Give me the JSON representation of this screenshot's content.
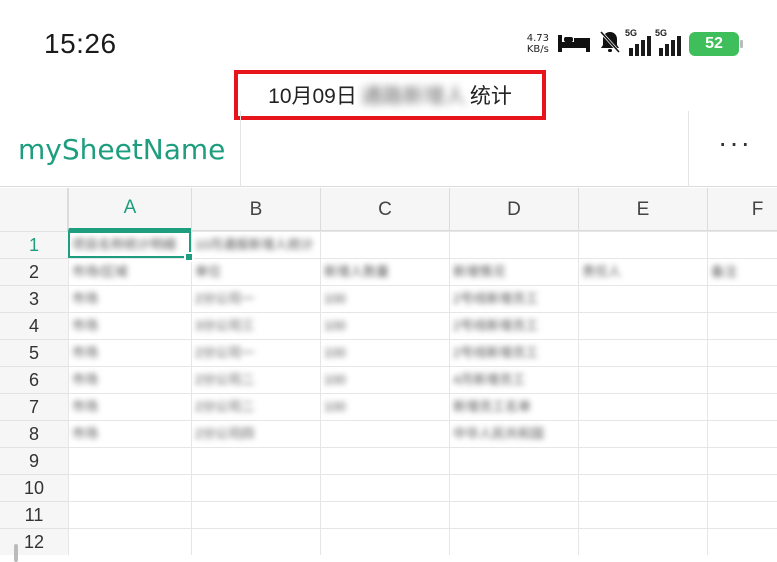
{
  "status_bar": {
    "time": "15:26",
    "net_speed_value": "4.73",
    "net_speed_unit": "KB/s",
    "signal1_label": "5G",
    "signal2_label": "5G",
    "battery": "52",
    "icons": [
      "bed-icon",
      "bell-muted-icon",
      "signal-icon",
      "signal-icon",
      "battery-icon"
    ],
    "battery_color": "#3fbf5b"
  },
  "document": {
    "title_prefix": "10月09日",
    "title_hidden": "通路新增人",
    "title_suffix": "统计",
    "highlight_color": "#e8141b"
  },
  "sheet": {
    "name": "mySheetName",
    "more_label": "···",
    "accent": "#1e9e7e"
  },
  "grid": {
    "columns": [
      "A",
      "B",
      "C",
      "D",
      "E",
      "F"
    ],
    "rows": [
      "1",
      "2",
      "3",
      "4",
      "5",
      "6",
      "7",
      "8",
      "9",
      "10",
      "11",
      "12"
    ],
    "cells": [
      [
        "项目名称统计明细",
        "10月通报新增人统计",
        "",
        "",
        "",
        ""
      ],
      [
        "市场/区域",
        "单位",
        "新增人数量",
        "新增情况",
        "责任人",
        "备注"
      ],
      [
        "市场",
        "2分公司一",
        "100",
        "2号线新增员工",
        "",
        ""
      ],
      [
        "市场",
        "3分公司三",
        "100",
        "2号线新增员工",
        "",
        ""
      ],
      [
        "市场",
        "2分公司一",
        "100",
        "2号线新增员工",
        "",
        ""
      ],
      [
        "市场",
        "2分公司二",
        "100",
        "4月新增员工",
        "",
        ""
      ],
      [
        "市场",
        "2分公司二",
        "100",
        "新增员工名单",
        "",
        ""
      ],
      [
        "市场",
        "2分公司四",
        "",
        "中华人民共和国",
        "",
        ""
      ]
    ]
  }
}
